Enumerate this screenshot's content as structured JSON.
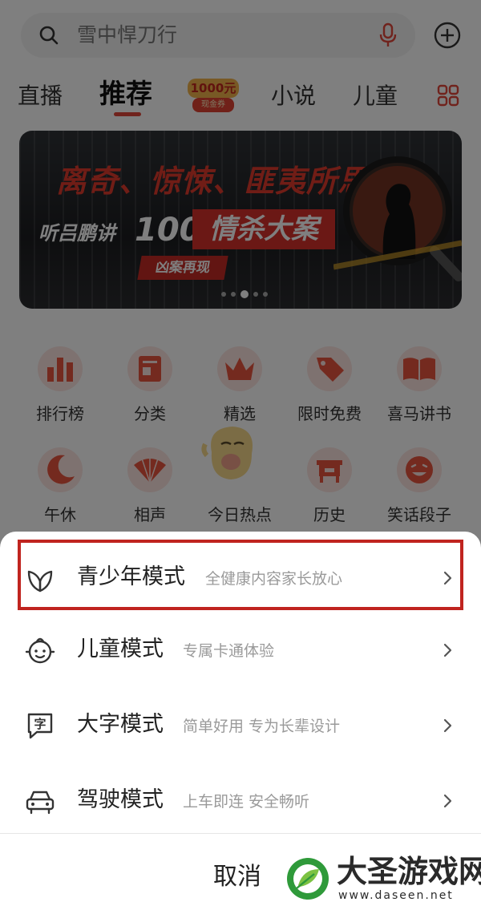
{
  "search": {
    "placeholder_text": "雪中悍刀行"
  },
  "tabs": [
    {
      "label": "直播"
    },
    {
      "label": "推荐"
    },
    {
      "label": "小说"
    },
    {
      "label": "儿童"
    }
  ],
  "promo": {
    "amount": "1000元",
    "sub": "现金券"
  },
  "banner": {
    "headline": "离奇、惊悚、匪夷所思",
    "line2_prefix": "听吕鹏讲",
    "line2_number": "100宗",
    "line2_highlight": "情杀大案",
    "tag": "凶案再现",
    "dot_count": 5,
    "active_dot": 3
  },
  "categories_row1": [
    {
      "label": "排行榜",
      "icon": "chart-bars-icon"
    },
    {
      "label": "分类",
      "icon": "category-list-icon"
    },
    {
      "label": "精选",
      "icon": "crown-icon"
    },
    {
      "label": "限时免费",
      "icon": "price-tag-icon"
    },
    {
      "label": "喜马讲书",
      "icon": "open-book-icon"
    }
  ],
  "categories_row2": [
    {
      "label": "午休",
      "icon": "moon-icon"
    },
    {
      "label": "相声",
      "icon": "folding-fan-icon"
    },
    {
      "label": "今日热点",
      "icon": "hot-icon"
    },
    {
      "label": "历史",
      "icon": "bronze-vessel-icon"
    },
    {
      "label": "笑话段子",
      "icon": "laughing-face-icon"
    }
  ],
  "sheet": {
    "modes": [
      {
        "title": "青少年模式",
        "subtitle": "全健康内容家长放心",
        "icon": "leaf-icon"
      },
      {
        "title": "儿童模式",
        "subtitle": "专属卡通体验",
        "icon": "child-face-icon"
      },
      {
        "title": "大字模式",
        "subtitle": "简单好用  专为长辈设计",
        "icon": "large-text-icon"
      },
      {
        "title": "驾驶模式",
        "subtitle": "上车即连  安全畅听",
        "icon": "car-icon"
      }
    ],
    "cancel_label": "取消"
  },
  "watermark": {
    "title": "大圣游戏网",
    "url": "www.daseen.net"
  },
  "colors": {
    "accent": "#e0463a",
    "highlight_border": "#c0241f"
  }
}
